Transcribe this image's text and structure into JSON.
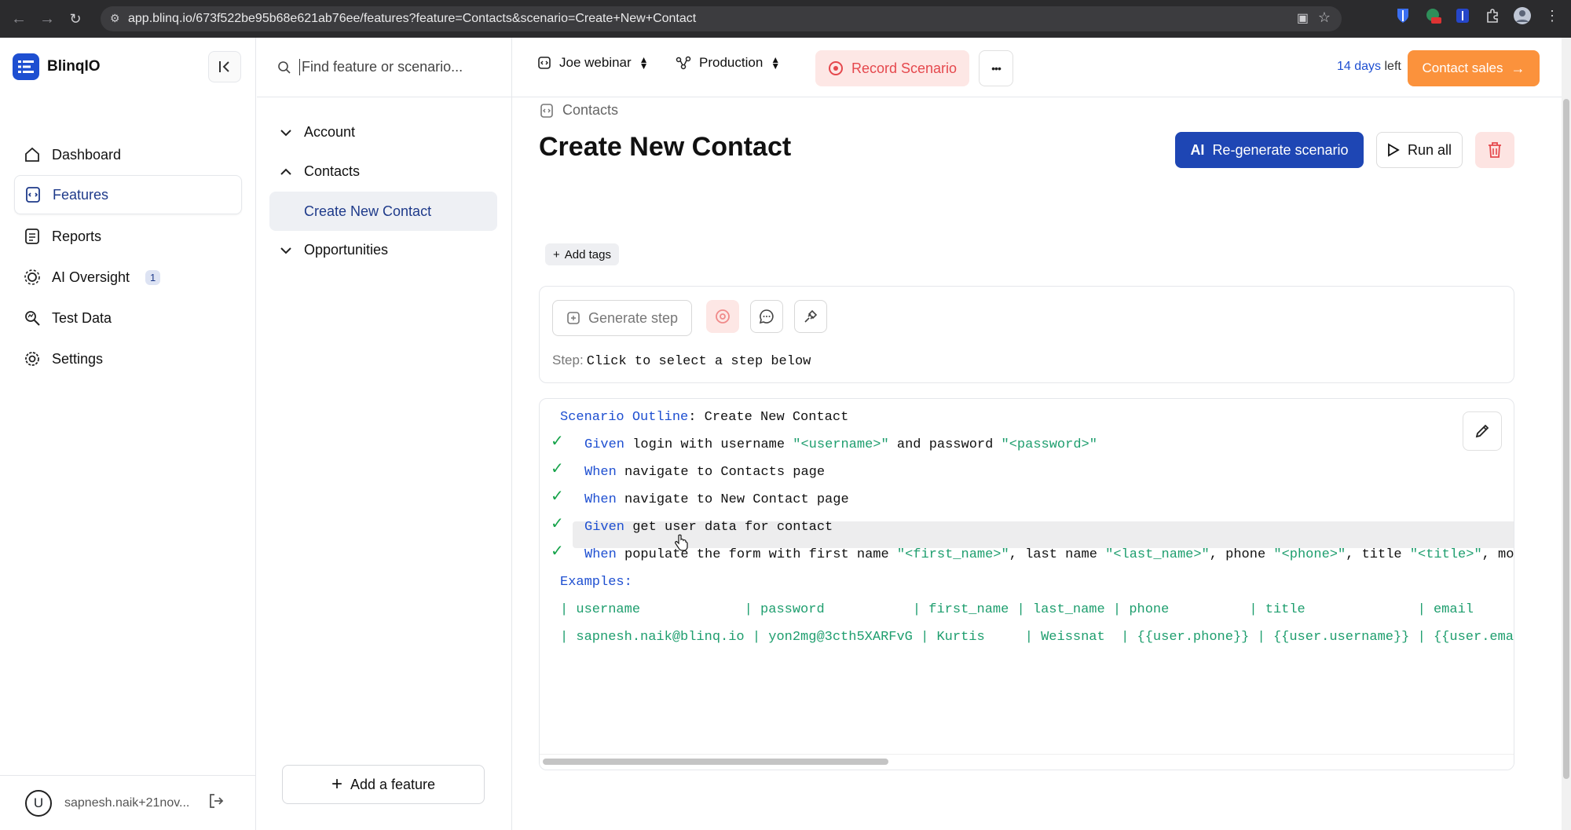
{
  "browser": {
    "url": "app.blinq.io/673f522be95b68e621ab76ee/features?feature=Contacts&scenario=Create+New+Contact"
  },
  "brand": {
    "name": "BlinqIO"
  },
  "nav": {
    "items": [
      {
        "label": "Dashboard",
        "icon": "home-icon"
      },
      {
        "label": "Features",
        "icon": "features-icon",
        "active": true
      },
      {
        "label": "Reports",
        "icon": "reports-icon"
      },
      {
        "label": "AI Oversight",
        "icon": "ai-oversight-icon",
        "badge": "1"
      },
      {
        "label": "Test Data",
        "icon": "test-data-icon"
      },
      {
        "label": "Settings",
        "icon": "gear-icon"
      }
    ]
  },
  "user": {
    "avatar_letter": "U",
    "email": "sapnesh.naik+21nov..."
  },
  "features_panel": {
    "search_placeholder": "Find feature or scenario...",
    "tree": [
      {
        "label": "Account",
        "expanded": false
      },
      {
        "label": "Contacts",
        "expanded": true,
        "children": [
          "Create New Contact"
        ]
      },
      {
        "label": "Opportunities",
        "expanded": false
      }
    ],
    "add_feature_label": "Add a feature"
  },
  "topbar": {
    "project": "Joe webinar",
    "environment": "Production",
    "record_label": "Record Scenario",
    "more_label": "•••",
    "days_number": "14 days",
    "days_suffix": " left",
    "contact_sales_label": "Contact sales",
    "colors": {
      "accent": "#1e46b4",
      "record": "#e5484d",
      "sales": "#fb923c"
    }
  },
  "scenario": {
    "breadcrumb": "Contacts",
    "title": "Create New Contact",
    "regen_prefix": "AI",
    "regen_label": "Re-generate scenario",
    "run_all_label": "Run all",
    "add_tags_label": "Add tags",
    "generate_step_label": "Generate step",
    "step_label": "Step:",
    "step_value": "Click to select a step below"
  },
  "code": {
    "outline_keyword": "Scenario Outline",
    "outline_name": ": Create New Contact",
    "steps": [
      {
        "kw": "Given",
        "parts": [
          {
            "t": " login with username "
          },
          {
            "s": "\"<username>\""
          },
          {
            "t": " and password "
          },
          {
            "s": "\"<password>\""
          }
        ]
      },
      {
        "kw": "When",
        "parts": [
          {
            "t": " navigate to Contacts page"
          }
        ]
      },
      {
        "kw": "When",
        "parts": [
          {
            "t": " navigate to New Contact page"
          }
        ]
      },
      {
        "kw": "Given",
        "parts": [
          {
            "t": " get user data for contact"
          }
        ]
      },
      {
        "kw": "When",
        "parts": [
          {
            "t": " populate the form with first name "
          },
          {
            "s": "\"<first_name>\""
          },
          {
            "t": ", last name "
          },
          {
            "s": "\"<last_name>\""
          },
          {
            "t": ", phone "
          },
          {
            "s": "\"<phone>\""
          },
          {
            "t": ", title "
          },
          {
            "s": "\"<title>\""
          },
          {
            "t": ", mobil"
          }
        ]
      }
    ],
    "examples_label": "Examples:",
    "example_header": "| username             | password           | first_name | last_name | phone          | title              | email",
    "example_row": "| sapnesh.naik@blinq.io | yon2mg@3cth5XARFvG | Kurtis     | Weissnat  | {{user.phone}} | {{user.username}} | {{user.email}"
  }
}
